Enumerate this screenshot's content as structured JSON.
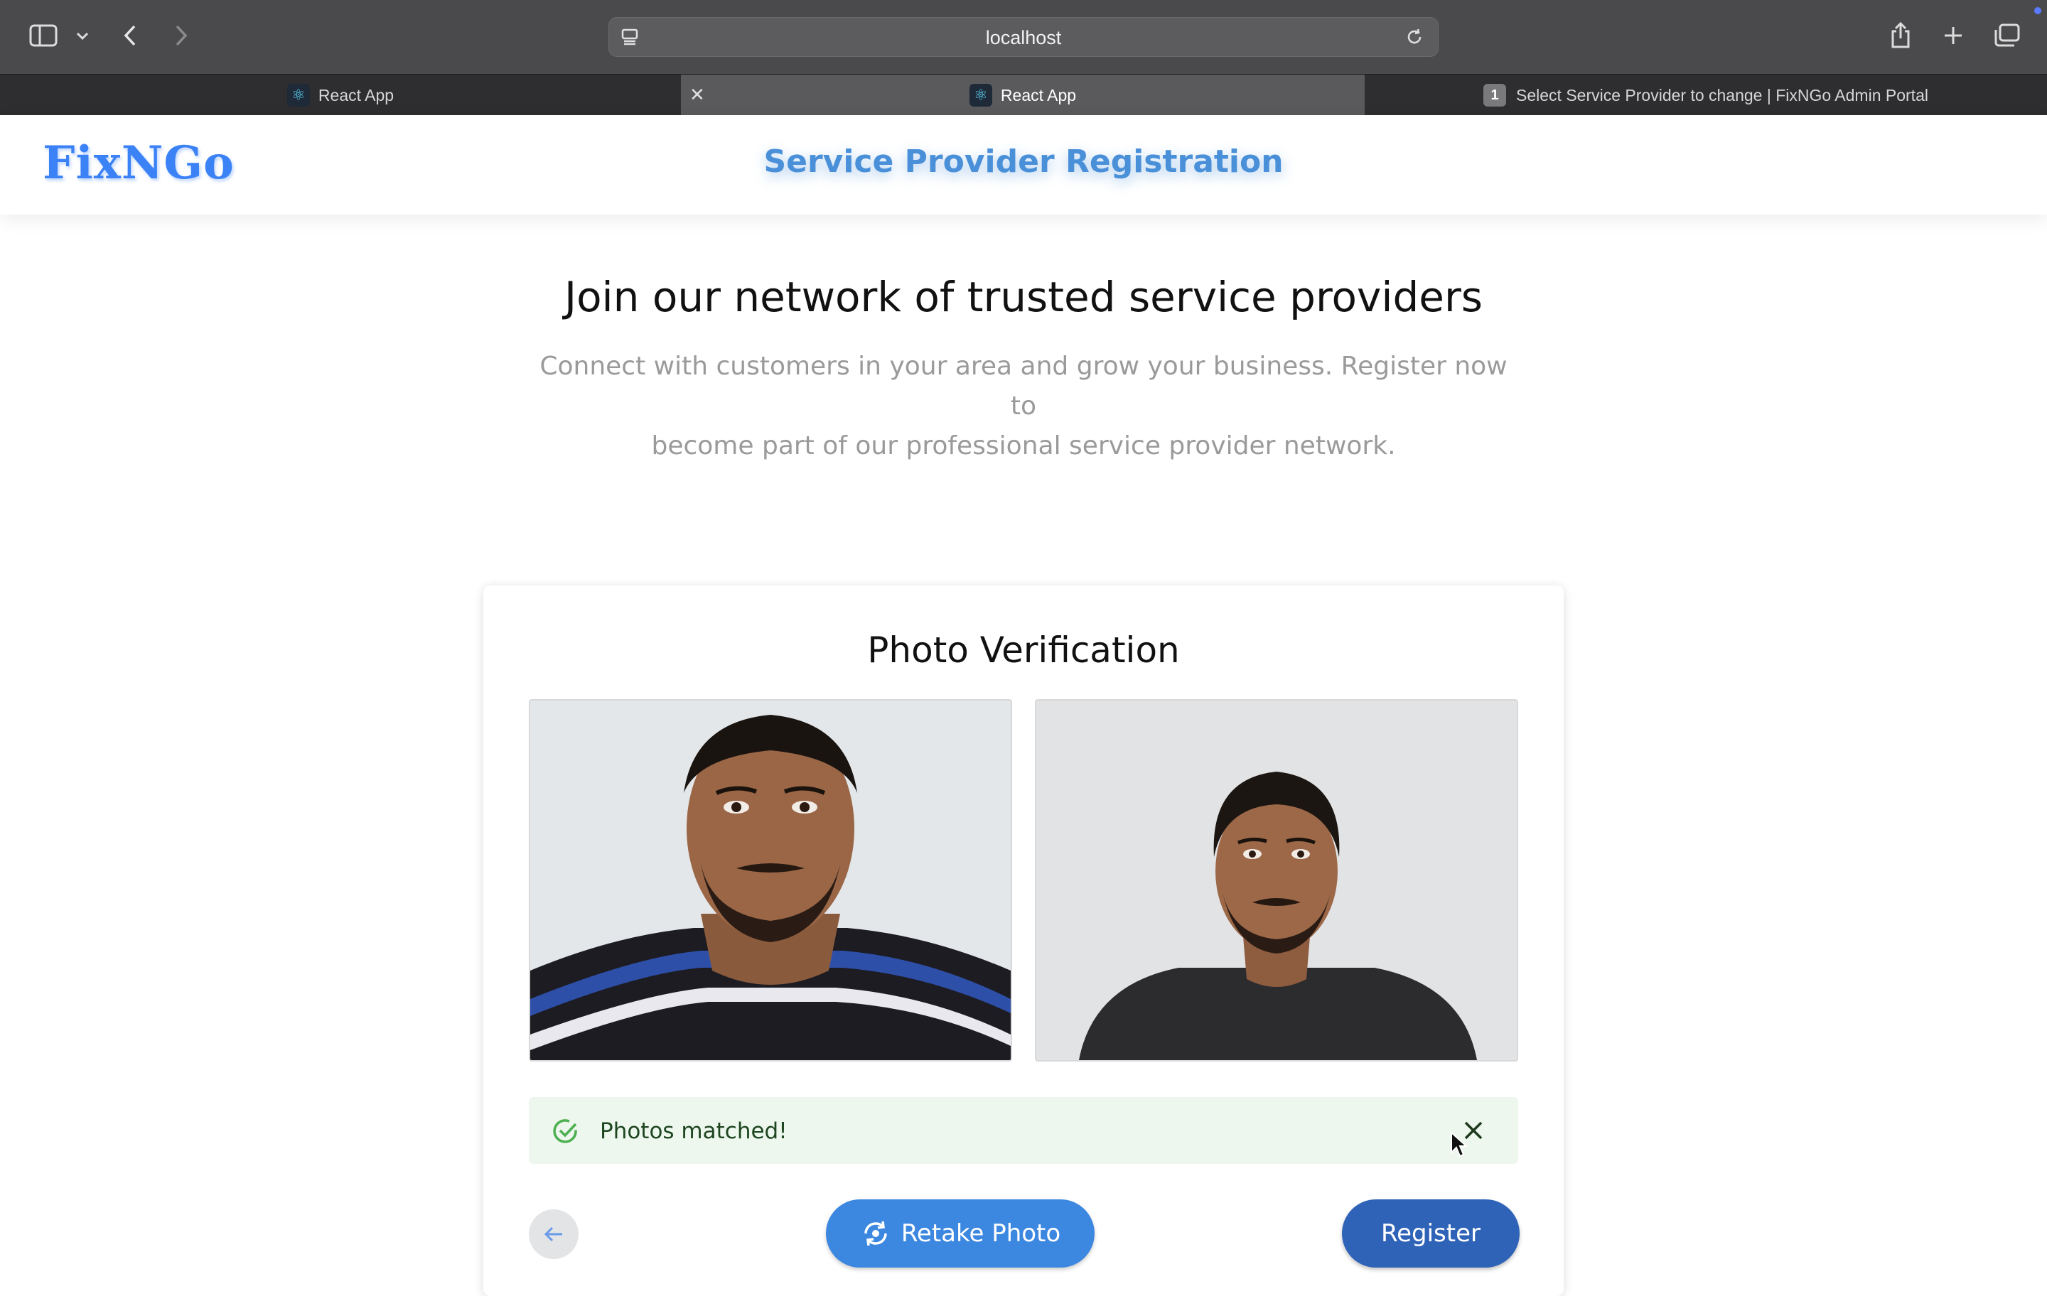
{
  "browser": {
    "url": "localhost",
    "tabs": [
      {
        "label": "React App"
      },
      {
        "label": "React App"
      },
      {
        "label": "Select Service Provider to change | FixNGo Admin Portal",
        "badge": "1"
      }
    ]
  },
  "header": {
    "logo": "FixNGo",
    "title": "Service Provider Registration"
  },
  "hero": {
    "title": "Join our network of trusted service providers",
    "subtitle_line1": "Connect with customers in your area and grow your business. Register now to",
    "subtitle_line2": "become part of our professional service provider network."
  },
  "verification": {
    "title": "Photo Verification",
    "alert": "Photos matched!",
    "retake_label": "Retake Photo",
    "register_label": "Register"
  },
  "colors": {
    "brand": "#3b82f6",
    "success_bg": "#edf7ed",
    "primary_button": "#3c87e0",
    "register_button": "#2f63b8"
  }
}
